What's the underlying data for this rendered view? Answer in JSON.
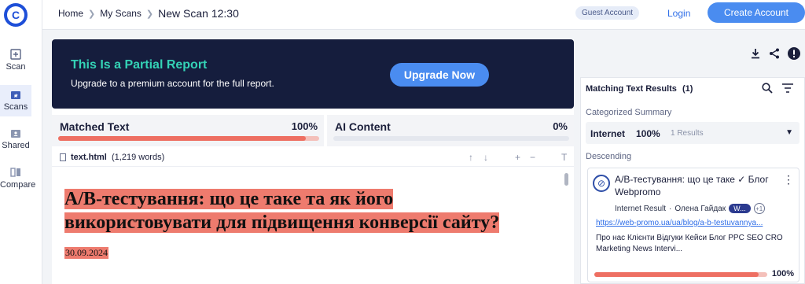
{
  "header": {
    "breadcrumbs": [
      "Home",
      "My Scans",
      "New Scan 12:30"
    ],
    "guest_badge": "Guest Account",
    "login": "Login",
    "create_account": "Create Account"
  },
  "rail": {
    "items": [
      {
        "label": "Scan",
        "icon": "scan-icon"
      },
      {
        "label": "Scans",
        "icon": "scans-icon"
      },
      {
        "label": "Shared",
        "icon": "shared-icon"
      },
      {
        "label": "Compare",
        "icon": "compare-icon"
      }
    ]
  },
  "banner": {
    "title": "This Is a Partial Report",
    "subtitle": "Upgrade to a premium account for the full report.",
    "button": "Upgrade Now"
  },
  "tabs": [
    {
      "label": "Matched Text",
      "percent": "100%",
      "fill": 0.95
    },
    {
      "label": "AI Content",
      "percent": "0%",
      "fill": 0
    }
  ],
  "file": {
    "name": "text.html",
    "words": "(1,219 words)"
  },
  "document": {
    "title": "А/В-тестування: що це таке та як його використовувати для підвищення конверсії сайту?",
    "date": "30.09.2024"
  },
  "results": {
    "title": "Matching Text Results",
    "count": "(1)",
    "categorized_label": "Categorized Summary",
    "internet_label": "Internet",
    "internet_percent": "100%",
    "internet_results": "1 Results",
    "descending_label": "Descending",
    "item": {
      "title": "А/В-тестування: що це таке ✓ Блог Webpromo",
      "type": "Internet Result",
      "author": "Олена Гайдак",
      "chip": "W...",
      "chip_more": "+1",
      "url": "https://web-promo.ua/ua/blog/a-b-testuvannya...",
      "snippet": "Про нас Клієнти Відгуки Кейси Блог PPC SEO CRO Marketing News Intervi...",
      "percent": "100%",
      "fill": 0.95
    }
  },
  "colors": {
    "brand_blue": "#4a8cf0",
    "banner_bg": "#151d3d",
    "banner_title": "#34d3b6",
    "match_highlight": "#ee7b6e"
  }
}
